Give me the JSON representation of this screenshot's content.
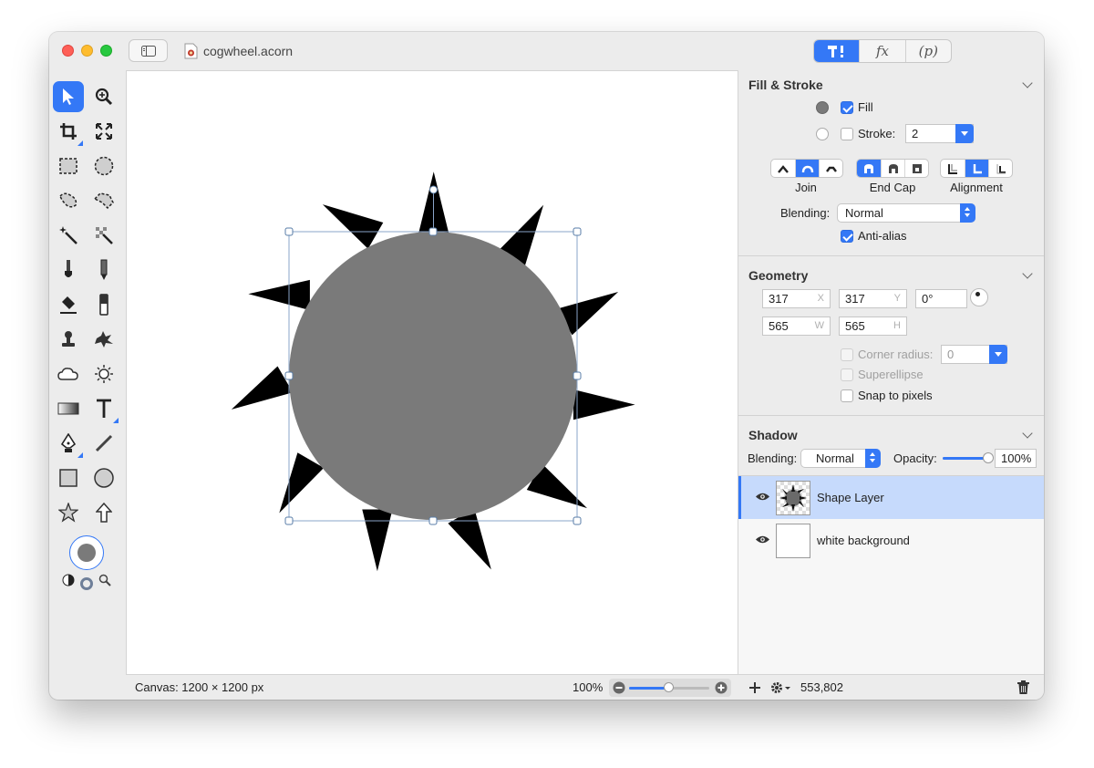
{
  "window": {
    "document_title": "cogwheel.acorn"
  },
  "top_tabs": [
    {
      "label": "",
      "icon": "tools-icon",
      "active": true
    },
    {
      "label": "fx",
      "icon": "",
      "active": false
    },
    {
      "label": "(p)",
      "icon": "",
      "active": false
    }
  ],
  "toolbar": {
    "tools": [
      "select-arrow",
      "zoom",
      "crop",
      "transform",
      "rect-select",
      "ellipse-select",
      "lasso-select",
      "polygon-lasso",
      "magic-wand",
      "instant-alpha",
      "brush",
      "pencil",
      "eraser-fill",
      "clone",
      "stamp",
      "smudge",
      "cloud",
      "sun",
      "gradient",
      "text",
      "pen",
      "line",
      "rectangle",
      "circle",
      "star",
      "arrow"
    ]
  },
  "canvas": {
    "status": "Canvas: 1200 × 1200 px",
    "zoom": "100%",
    "zoom_fraction": 0.5
  },
  "fill_stroke": {
    "title": "Fill & Stroke",
    "fill_label": "Fill",
    "fill_checked": true,
    "stroke_label": "Stroke:",
    "stroke_checked": false,
    "stroke_value": "2",
    "join_label": "Join",
    "endcap_label": "End Cap",
    "alignment_label": "Alignment",
    "blending_label": "Blending:",
    "blending_value": "Normal",
    "antialias_label": "Anti-alias",
    "antialias_checked": true,
    "fill_color": "#7a7a7a"
  },
  "geometry": {
    "title": "Geometry",
    "x_value": "317",
    "x_unit": "X",
    "y_value": "317",
    "y_unit": "Y",
    "angle_value": "0°",
    "w_value": "565",
    "w_unit": "W",
    "h_value": "565",
    "h_unit": "H",
    "corner_radius_label": "Corner radius:",
    "corner_radius_value": "0",
    "superellipse_label": "Superellipse",
    "snap_label": "Snap to pixels"
  },
  "shadow": {
    "title": "Shadow",
    "blending_label": "Blending:",
    "blending_value": "Normal",
    "opacity_label": "Opacity:",
    "opacity_value": "100%",
    "opacity_fraction": 1.0
  },
  "layers": [
    {
      "name": "Shape Layer",
      "selected": true
    },
    {
      "name": "white background",
      "selected": false
    }
  ],
  "layers_footer": {
    "coords": "553,802"
  },
  "colors": {
    "accent": "#3478f6",
    "shape_fill": "#7a7a7a",
    "spikes": "#000000"
  }
}
